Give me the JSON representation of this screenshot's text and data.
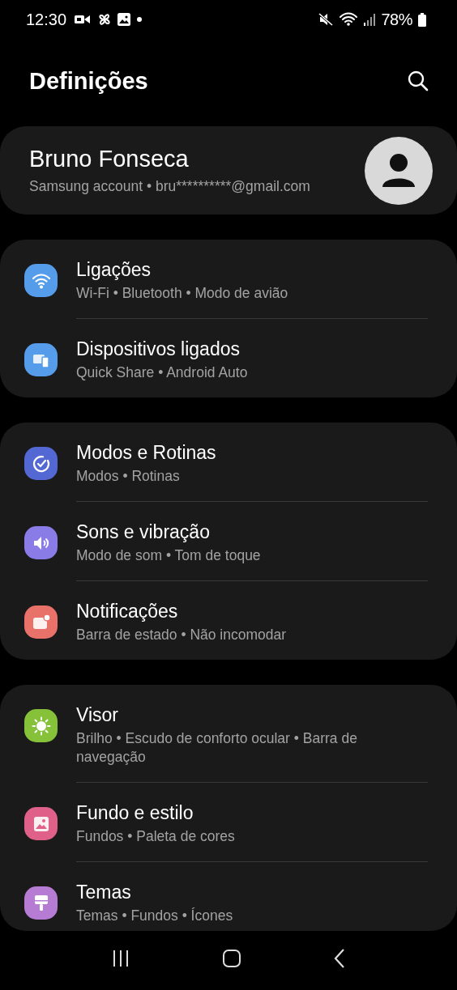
{
  "status_bar": {
    "time": "12:30",
    "battery": "78%"
  },
  "header": {
    "title": "Definições"
  },
  "account": {
    "name": "Bruno Fonseca",
    "subtitle": "Samsung account  •  bru**********@gmail.com"
  },
  "groups": [
    {
      "items": [
        {
          "title": "Ligações",
          "subtitle": "Wi-Fi  •  Bluetooth  •  Modo de avião",
          "color": "#559cea"
        },
        {
          "title": "Dispositivos ligados",
          "subtitle": "Quick Share  •  Android Auto",
          "color": "#559cea"
        }
      ]
    },
    {
      "items": [
        {
          "title": "Modos e Rotinas",
          "subtitle": "Modos  •  Rotinas",
          "color": "#5468d4"
        },
        {
          "title": "Sons e vibração",
          "subtitle": "Modo de som  •  Tom de toque",
          "color": "#8a7ce6"
        },
        {
          "title": "Notificações",
          "subtitle": "Barra de estado  •  Não incomodar",
          "color": "#e8716a"
        }
      ]
    },
    {
      "items": [
        {
          "title": "Visor",
          "subtitle": "Brilho  •  Escudo de conforto ocular  •  Barra de navegação",
          "color": "#86c13a"
        },
        {
          "title": "Fundo e estilo",
          "subtitle": "Fundos  •  Paleta de cores",
          "color": "#df6189"
        },
        {
          "title": "Temas",
          "subtitle": "Temas  •  Fundos  •  Ícones",
          "color": "#b67cd4"
        }
      ]
    }
  ]
}
